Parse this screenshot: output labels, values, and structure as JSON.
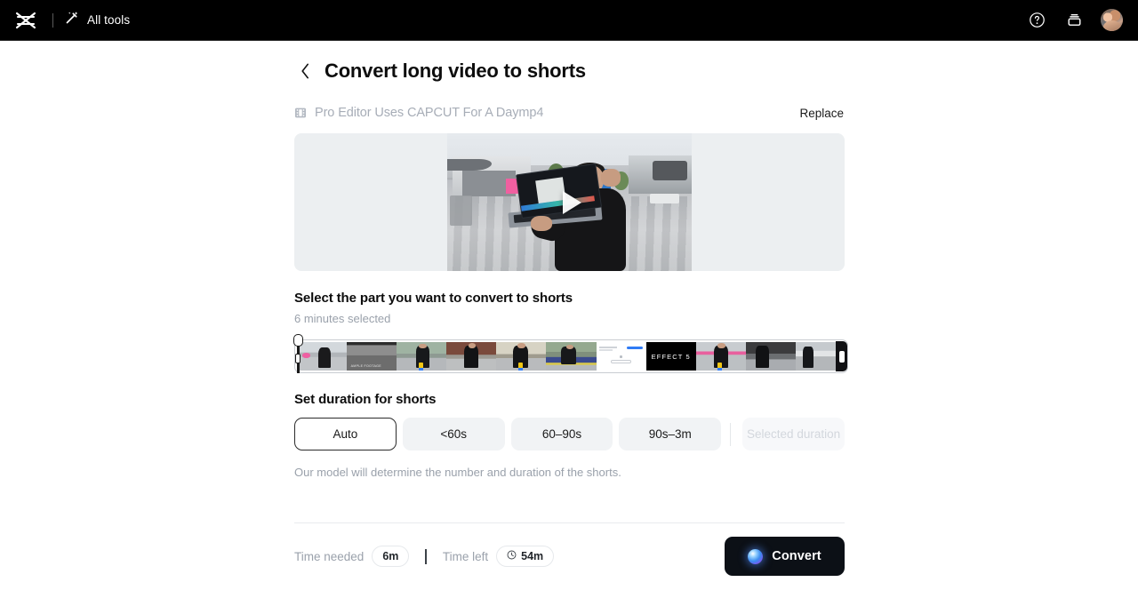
{
  "topbar": {
    "logo_icon": "capcut-logo-icon",
    "magic_icon": "magic-wand-icon",
    "all_tools_label": "All tools",
    "help_icon": "help-circle-icon",
    "inbox_icon": "archive-tray-icon",
    "avatar_alt": "user-avatar"
  },
  "page": {
    "back_icon": "chevron-left-icon",
    "title": "Convert long video to shorts"
  },
  "file": {
    "icon": "film-strip-icon",
    "name": "Pro Editor Uses CAPCUT For A Daymp4",
    "replace_label": "Replace"
  },
  "player": {
    "play_icon": "play-triangle-icon",
    "background_color": "#eceff1"
  },
  "select_section": {
    "title": "Select the part you want to convert to shorts",
    "selection_note": "6 minutes selected"
  },
  "timeline": {
    "left_handle": "trim-handle-left",
    "right_handle": "trim-handle-right",
    "frames": [
      {
        "kind": "plaza",
        "label": ""
      },
      {
        "kind": "bw",
        "label": "AMPLE FOOTAGE"
      },
      {
        "kind": "street",
        "label": ""
      },
      {
        "kind": "brick",
        "label": ""
      },
      {
        "kind": "sun",
        "label": ""
      },
      {
        "kind": "desk",
        "label": ""
      },
      {
        "kind": "ui",
        "label": ""
      },
      {
        "kind": "effect",
        "label": "EFFECT 5"
      },
      {
        "kind": "pinkcar",
        "label": ""
      },
      {
        "kind": "dark",
        "label": ""
      },
      {
        "kind": "wide",
        "label": ""
      }
    ]
  },
  "duration_section": {
    "title": "Set duration for shorts",
    "options": [
      {
        "label": "Auto",
        "selected": true,
        "disabled": false
      },
      {
        "label": "<60s",
        "selected": false,
        "disabled": false
      },
      {
        "label": "60–90s",
        "selected": false,
        "disabled": false
      },
      {
        "label": "90s–3m",
        "selected": false,
        "disabled": false
      },
      {
        "label": "Selected duration",
        "selected": false,
        "disabled": true
      }
    ],
    "note": "Our model will determine the number and duration of the shorts."
  },
  "footer": {
    "time_needed_label": "Time needed",
    "time_needed_value": "6m",
    "time_left_label": "Time left",
    "time_left_value": "54m",
    "time_left_icon": "clock-icon",
    "convert_label": "Convert",
    "convert_icon": "ai-orb-icon"
  },
  "colors": {
    "topbar_bg": "#000000",
    "page_bg": "#ffffff",
    "accent_button": "#0c1016",
    "muted_text": "#9aa1ab",
    "chip_bg": "#f1f3f5"
  }
}
